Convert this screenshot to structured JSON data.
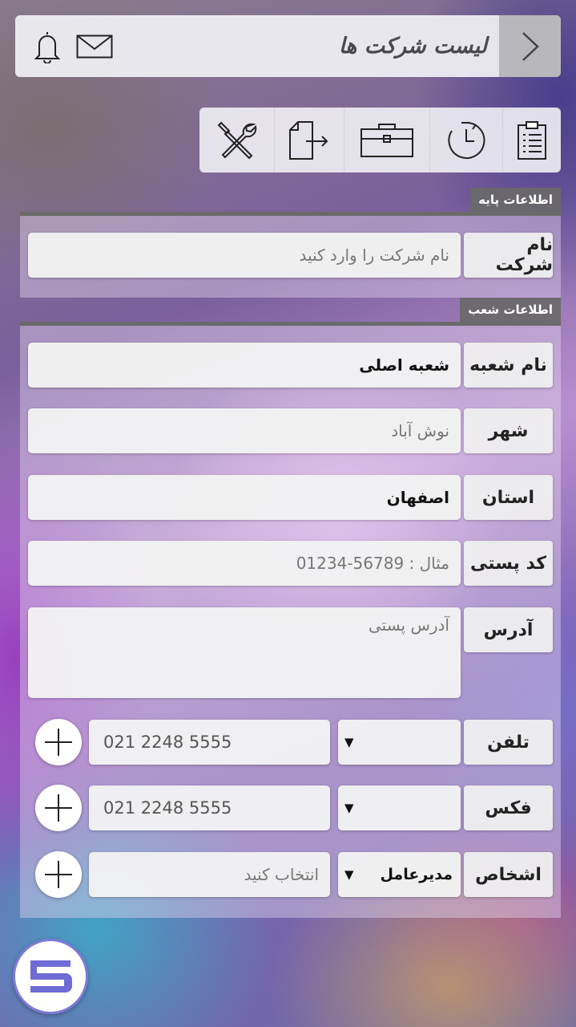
{
  "header": {
    "title": "لیست شرکت ها",
    "back_icon": "chevron-right-icon",
    "bell_icon": "bell-icon",
    "mail_icon": "mail-icon"
  },
  "toolbar": {
    "items": [
      {
        "icon": "clipboard-icon"
      },
      {
        "icon": "history-icon"
      },
      {
        "icon": "briefcase-icon"
      },
      {
        "icon": "export-file-icon"
      },
      {
        "icon": "tools-icon"
      }
    ]
  },
  "base_info": {
    "section_title": "اطلاعات پایه",
    "company_name_label": "نام شرکت",
    "company_name_placeholder": "نام شرکت را وارد کنید"
  },
  "branch_info": {
    "section_title": "اطلاعات شعب",
    "branch_name_label": "نام شعبه",
    "branch_name_value": "شعبه اصلی",
    "city_label": "شهر",
    "city_placeholder": "نوش آباد",
    "province_label": "استان",
    "province_value": "اصفهان",
    "postal_label": "کد پستی",
    "postal_placeholder": "مثال : 56789-01234",
    "address_label": "آدرس",
    "address_placeholder": "آدرس پستی",
    "phone_label": "تلفن",
    "phone_placeholder": "021 2248 5555",
    "phone_type_value": "",
    "fax_label": "فکس",
    "fax_placeholder": "021 2248 5555",
    "fax_type_value": "",
    "persons_label": "اشخاص",
    "persons_role_value": "مدیرعامل",
    "persons_placeholder": "انتخاب کنید",
    "dropdown_arrow": "▼"
  },
  "colors": {
    "accent": "#7e7ad8",
    "section_tag": "#696969"
  }
}
